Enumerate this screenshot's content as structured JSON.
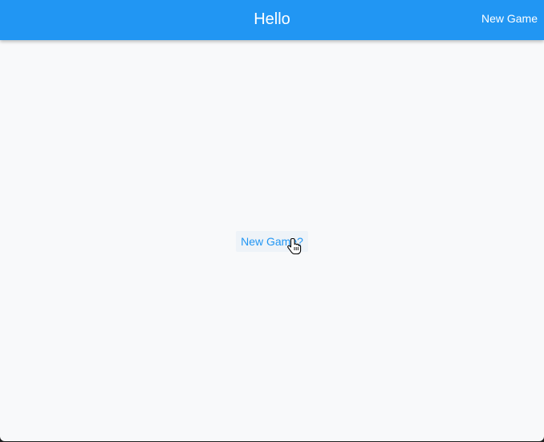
{
  "app_bar": {
    "title": "Hello",
    "action_label": "New Game",
    "color": "#2196f3"
  },
  "main": {
    "center_button_label": "New Game?",
    "background": "#f8f9fa",
    "accent": "#2196f3"
  },
  "cursor": {
    "icon": "hand-pointer-icon"
  }
}
